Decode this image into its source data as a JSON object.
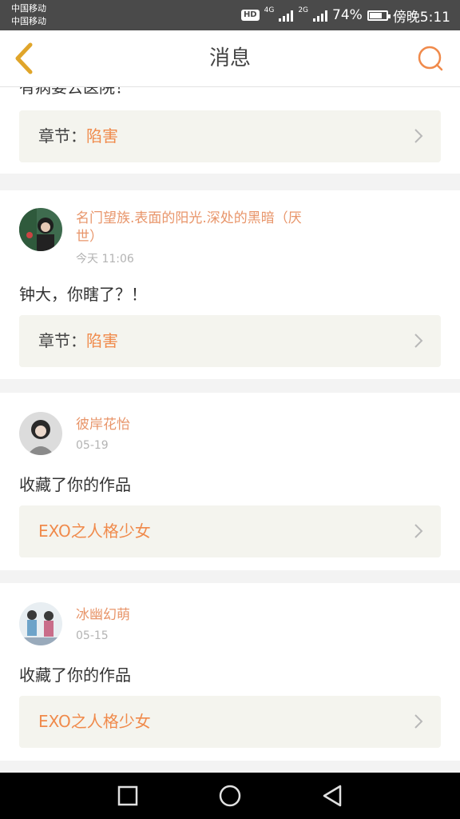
{
  "status": {
    "carrier1": "中国移动",
    "carrier2": "中国移动",
    "hd": "HD",
    "net1": "4G",
    "net2": "2G",
    "battery_percent": "74%",
    "battery_level": 0.74,
    "time": "傍晚5:11"
  },
  "header": {
    "title": "消息",
    "back_icon": "chevron-left-icon",
    "search_icon": "search-icon"
  },
  "partial": {
    "text": "有病要去医院！",
    "chapter_label": "章节：",
    "chapter_value": "陷害"
  },
  "messages": [
    {
      "username": "名门望族.表面的阳光.深处的黑暗（厌世）",
      "time": "今天 11:06",
      "text": "钟大，你瞎了？！",
      "chapter_label": "章节：",
      "chapter_value": "陷害"
    },
    {
      "username": "彼岸花怡",
      "time": "05-19",
      "text": "收藏了你的作品",
      "work_title": "EXO之人格少女"
    },
    {
      "username": "冰幽幻萌",
      "time": "05-15",
      "text": "收藏了你的作品",
      "work_title": "EXO之人格少女"
    }
  ],
  "colors": {
    "accent": "#f08a4b",
    "username": "#e8956a",
    "back_icon": "#e0a52a",
    "link_box_bg": "#f4f4ee"
  },
  "nav": {
    "recent_icon": "square-icon",
    "home_icon": "circle-icon",
    "back_icon": "triangle-back-icon"
  }
}
